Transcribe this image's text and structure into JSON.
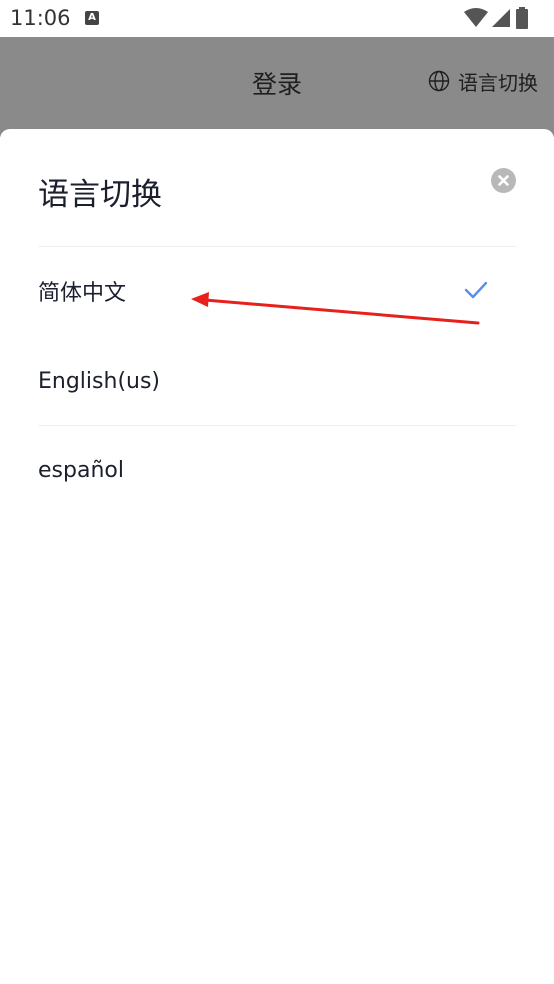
{
  "status_bar": {
    "time": "11:06",
    "notification_icon": "A"
  },
  "header": {
    "title": "登录",
    "language_button_label": "语言切换"
  },
  "sheet": {
    "title": "语言切换",
    "languages": [
      {
        "label": "简体中文",
        "selected": true
      },
      {
        "label": "English(us)",
        "selected": false
      },
      {
        "label": "español",
        "selected": false
      }
    ]
  },
  "colors": {
    "check": "#5b8def",
    "arrow": "#e8201c",
    "dim_header": "#8a8a8a"
  },
  "icons": [
    "notification-a-icon",
    "wifi-icon",
    "signal-icon",
    "battery-icon",
    "globe-icon",
    "close-icon",
    "checkmark-icon",
    "red-arrow-annotation"
  ]
}
